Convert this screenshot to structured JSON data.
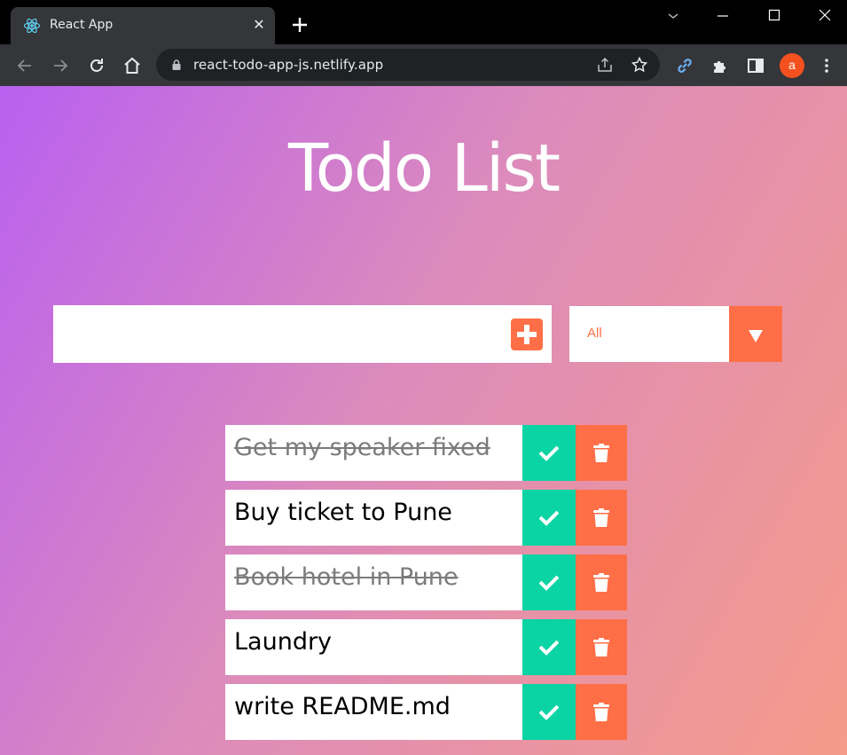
{
  "browser": {
    "tab_title": "React App",
    "url": "react-todo-app-js.netlify.app",
    "avatar_letter": "a"
  },
  "app": {
    "title": "Todo List",
    "input": {
      "value": "",
      "placeholder": ""
    },
    "filter": {
      "selected": "All"
    },
    "todos": [
      {
        "text": "Get my speaker fixed",
        "completed": true
      },
      {
        "text": "Buy ticket to Pune",
        "completed": false
      },
      {
        "text": "Book hotel in Pune",
        "completed": true
      },
      {
        "text": "Laundry",
        "completed": false
      },
      {
        "text": "write README.md",
        "completed": false
      }
    ]
  },
  "colors": {
    "accent": "#ff6f47",
    "complete": "#0ad4a3",
    "gradient_start": "#b960f0",
    "gradient_end": "#f59b8a"
  },
  "icons": {
    "add": "plus-square-icon",
    "filter_arrow": "caret-down-icon",
    "complete": "check-icon",
    "delete": "trash-icon"
  }
}
